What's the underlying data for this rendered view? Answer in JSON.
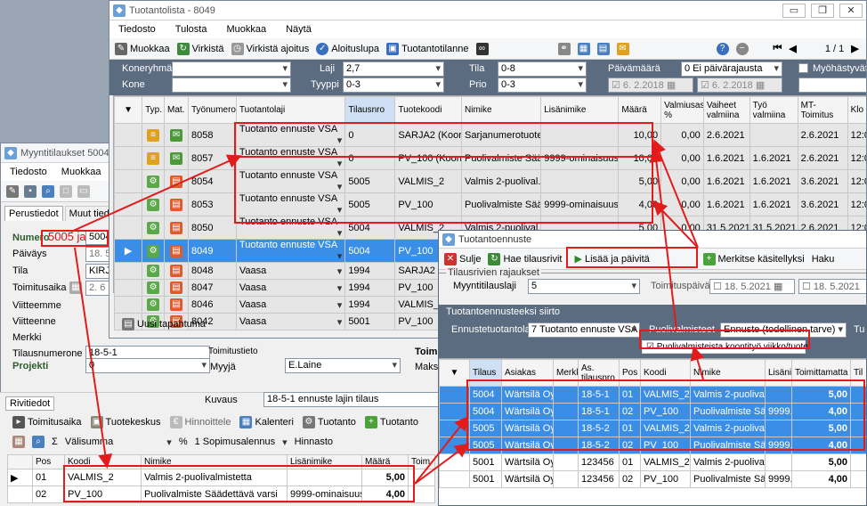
{
  "colors": {
    "selection": "#3b8ee6",
    "highlight": "#e21b1b",
    "filter_panel": "#5b6b80"
  },
  "tuotanto": {
    "title": "Tuotantolista - 8049",
    "menu": [
      "Tiedosto",
      "Tulosta",
      "Muokkaa",
      "Näytä"
    ],
    "toolbar": {
      "muokkaa": "Muokkaa",
      "virkista": "Virkistä",
      "virkista_ajoitus": "Virkistä ajoitus",
      "aloituslupa": "Aloituslupa",
      "tuotantotilanne": "Tuotantotilanne",
      "pager": "1 / 1"
    },
    "filters": {
      "koneryhma_label": "Koneryhmä",
      "kone_label": "Kone",
      "laji_label": "Laji",
      "laji_value": "2,7",
      "tyyppi_label": "Tyyppi",
      "tyyppi_value": "0-3",
      "tila_label": "Tila",
      "tila_value": "0-8",
      "prio_label": "Prio",
      "prio_value": "0-3",
      "paivamaara_label": "Päivämäärä",
      "paivamaara_value": "0 Ei päivärajausta",
      "myohastyvat_label": "Myöhästyvät",
      "date1": "6. 2.2018",
      "date2": "6. 2.2018"
    },
    "columns": [
      "Typ.",
      "Mat.",
      "Työnumero",
      "Tuotantolaji",
      "Tilausnro",
      "Tuotekoodi",
      "Nimike",
      "Lisänimike",
      "Määrä",
      "Valmiusaste %",
      "Vaiheet valmiina",
      "Työ valmiina",
      "MT-Toimitus",
      "Klo"
    ],
    "rows": [
      {
        "typ": "≡",
        "tyo": "8058",
        "laji": "Tuotanto ennuste VSA",
        "tilaus": "0",
        "koodi": "SARJA2 (Koonti)",
        "nimike": "Sarjanumerotuote 2",
        "lisa": "",
        "maara": "10,00",
        "valmius": "0,00",
        "vaiheet": "2.6.2021",
        "tyov": "",
        "mt": "2.6.2021",
        "klo": "12:05",
        "style": "grey"
      },
      {
        "typ": "≡",
        "tyo": "8057",
        "laji": "Tuotanto ennuste VSA",
        "tilaus": "0",
        "koodi": "PV_100 (Koonti)",
        "nimike": "Puolivalmiste Sää...",
        "lisa": "9999-ominaisuus",
        "maara": "10,00",
        "valmius": "0,00",
        "vaiheet": "1.6.2021",
        "tyov": "1.6.2021",
        "mt": "2.6.2021",
        "klo": "12:05",
        "style": "grey"
      },
      {
        "typ": "⚙",
        "tyo": "8054",
        "laji": "Tuotanto ennuste VSA",
        "tilaus": "5005",
        "koodi": "VALMIS_2",
        "nimike": "Valmis 2-puolival...",
        "lisa": "",
        "maara": "5,00",
        "valmius": "0,00",
        "vaiheet": "1.6.2021",
        "tyov": "1.6.2021",
        "mt": "3.6.2021",
        "klo": "12:05",
        "style": "grey"
      },
      {
        "typ": "⚙",
        "tyo": "8053",
        "laji": "Tuotanto ennuste VSA",
        "tilaus": "5005",
        "koodi": "PV_100",
        "nimike": "Puolivalmiste Sää...",
        "lisa": "9999-ominaisuus",
        "maara": "4,00",
        "valmius": "0,00",
        "vaiheet": "1.6.2021",
        "tyov": "1.6.2021",
        "mt": "3.6.2021",
        "klo": "12:05",
        "style": "grey"
      },
      {
        "typ": "⚙",
        "tyo": "8050",
        "laji": "Tuotanto ennuste VSA",
        "tilaus": "5004",
        "koodi": "VALMIS_2",
        "nimike": "Valmis 2-puolival...",
        "lisa": "",
        "maara": "5,00",
        "valmius": "0,00",
        "vaiheet": "31.5.2021",
        "tyov": "31.5.2021",
        "mt": "2.6.2021",
        "klo": "12:05",
        "style": "grey"
      },
      {
        "typ": "⚙",
        "tyo": "8049",
        "laji": "Tuotanto ennuste VSA",
        "tilaus": "5004",
        "koodi": "PV_100",
        "nimike": "Puolivalmiste Sää...",
        "lisa": "9999-ominaisuus",
        "maara": "4,00",
        "valmius": "0,00",
        "vaiheet": "31.5.2021",
        "tyov": "31.5.2021",
        "mt": "2.6.2021",
        "klo": "12:05",
        "style": "sel"
      },
      {
        "typ": "⚙",
        "tyo": "8048",
        "laji": "Vaasa",
        "tilaus": "1994",
        "koodi": "SARJA2",
        "nimike": "",
        "lisa": "",
        "maara": "",
        "valmius": "",
        "vaiheet": "",
        "tyov": "",
        "mt": "",
        "klo": "",
        "style": "grey"
      },
      {
        "typ": "⚙",
        "tyo": "8047",
        "laji": "Vaasa",
        "tilaus": "1994",
        "koodi": "PV_100",
        "nimike": "",
        "lisa": "",
        "maara": "",
        "valmius": "",
        "vaiheet": "",
        "tyov": "",
        "mt": "",
        "klo": "",
        "style": "grey"
      },
      {
        "typ": "⚙",
        "tyo": "8046",
        "laji": "Vaasa",
        "tilaus": "1994",
        "koodi": "VALMIS_2",
        "nimike": "",
        "lisa": "",
        "maara": "",
        "valmius": "",
        "vaiheet": "",
        "tyov": "",
        "mt": "",
        "klo": "",
        "style": "grey"
      },
      {
        "typ": "⚙",
        "tyo": "8042",
        "laji": "Vaasa",
        "tilaus": "5001",
        "koodi": "PV_100",
        "nimike": "",
        "lisa": "",
        "maara": "",
        "valmius": "",
        "vaiheet": "",
        "tyov": "",
        "mt": "",
        "klo": "",
        "style": "grey"
      }
    ],
    "uusi_tapahtuma": "Uusi tapahtuma"
  },
  "myynti": {
    "title": "Myyntitilaukset 5004 1",
    "menu": [
      "Tiedosto",
      "Muokkaa"
    ],
    "tabs": [
      "Perustiedot",
      "Muut tiedot"
    ],
    "fields": {
      "numero_label": "Numero",
      "numero_overlay": "5005 ja",
      "numero_value": "5004",
      "paivays_label": "Päiväys",
      "paivays_value": "18. 5",
      "tila_label": "Tila",
      "tila_value": "KIRJA",
      "toimitusaika_label": "Toimitusaika",
      "toimitusaika_value": "2. 6",
      "viitteemme_label": "Viitteemme",
      "viitteenne_label": "Viitteenne",
      "merkki_label": "Merkki",
      "tilausnumerone_label": "Tilausnumerone",
      "tilausnumerone_value": "18-5-1",
      "toimitustieto_label": "Toimitustieto",
      "projekti_label": "Projekti",
      "projekti_value": "0",
      "myyja_label": "Myyjä",
      "myyja_value": "E.Laine",
      "toim_label": "Toim",
      "maksu_label": "Maksu"
    },
    "rivitiedot": "Rivitiedot",
    "kuvaus_label": "Kuvaus",
    "kuvaus_value": "18-5-1 ennuste lajin tilaus",
    "row_toolbar": [
      "Toimitusaika",
      "Tuotekeskus",
      "Hinnoittele",
      "Kalenteri",
      "Tuotanto",
      "Tuotanto"
    ],
    "row_toolbar2": {
      "valisumma": "Välisumma",
      "percent": "%",
      "sopimus": "1 Sopimusalennus",
      "hinnasto": "Hinnasto"
    },
    "row_columns": [
      "Pos",
      "Koodi",
      "Nimike",
      "Lisänimike",
      "Määrä",
      "Toim"
    ],
    "rows": [
      {
        "pos": "01",
        "koodi": "VALMIS_2",
        "nimike": "Valmis 2-puolivalmistetta",
        "lisa": "",
        "maara": "5,00"
      },
      {
        "pos": "02",
        "koodi": "PV_100",
        "nimike": "Puolivalmiste Säädettävä varsi",
        "lisa": "9999-ominaisuus",
        "maara": "4,00"
      }
    ]
  },
  "ennuste": {
    "title": "Tuotantoennuste",
    "toolbar": {
      "sulje": "Sulje",
      "hae": "Hae tilausrivit",
      "lisaa": "Lisää ja päivitä",
      "merkitse": "Merkitse käsitellyksi",
      "haku": "Haku"
    },
    "rajaukset_title": "Tilausrivien rajaukset",
    "myyntilausloji_label": "Myyntitilauslaji",
    "myyntilausloji_value": "5",
    "toimituspaiva_label": "Toimituspäivä",
    "date1": "18. 5.2021",
    "date2": "18. 5.2021",
    "siirto_title": "Tuotantoennusteeksi siirto",
    "ennustetuotantolaji_label": "Ennustetuotantolaji",
    "ennustetuotantolaji_value": "7 Tuotanto ennuste VSA",
    "puolivalmisteet_label": "Puolivalmisteet",
    "puolivalmisteet_value": "Ennuste (todellinen tarve)",
    "checkbox_label": "Puolivalmisteista koontityö viikko/tuote",
    "tu_label": "Tu",
    "columns": [
      "Tilaus",
      "Asiakas",
      "Merkki",
      "As. tilausnro",
      "Pos",
      "Koodi",
      "Nimike",
      "Lisänimi",
      "Toimittamatta",
      "Til"
    ],
    "rows": [
      {
        "tilaus": "5004",
        "asiakas": "Wärtsilä Oyj",
        "merkki": "",
        "astil": "18-5-1",
        "pos": "01",
        "koodi": "VALMIS_2",
        "nimike": "Valmis 2-puolival...",
        "lisa": "",
        "toim": "5,00",
        "sel": true
      },
      {
        "tilaus": "5004",
        "asiakas": "Wärtsilä Oyj",
        "merkki": "",
        "astil": "18-5-1",
        "pos": "02",
        "koodi": "PV_100",
        "nimike": "Puolivalmiste Sää...",
        "lisa": "9999...",
        "toim": "4,00",
        "sel": true
      },
      {
        "tilaus": "5005",
        "asiakas": "Wärtsilä Oyj",
        "merkki": "",
        "astil": "18-5-2",
        "pos": "01",
        "koodi": "VALMIS_2",
        "nimike": "Valmis 2-puolival...",
        "lisa": "",
        "toim": "5,00",
        "sel": true
      },
      {
        "tilaus": "5005",
        "asiakas": "Wärtsilä Oyj",
        "merkki": "",
        "astil": "18-5-2",
        "pos": "02",
        "koodi": "PV_100",
        "nimike": "Puolivalmiste Sää...",
        "lisa": "9999...",
        "toim": "4,00",
        "sel": true
      },
      {
        "tilaus": "5001",
        "asiakas": "Wärtsilä Oyj",
        "merkki": "",
        "astil": "123456",
        "pos": "01",
        "koodi": "VALMIS_2",
        "nimike": "Valmis 2-puolival...",
        "lisa": "",
        "toim": "5,00",
        "sel": false
      },
      {
        "tilaus": "5001",
        "asiakas": "Wärtsilä Oyj",
        "merkki": "",
        "astil": "123456",
        "pos": "02",
        "koodi": "PV_100",
        "nimike": "Puolivalmiste Sää...",
        "lisa": "9999...",
        "toim": "4,00",
        "sel": false
      }
    ]
  }
}
